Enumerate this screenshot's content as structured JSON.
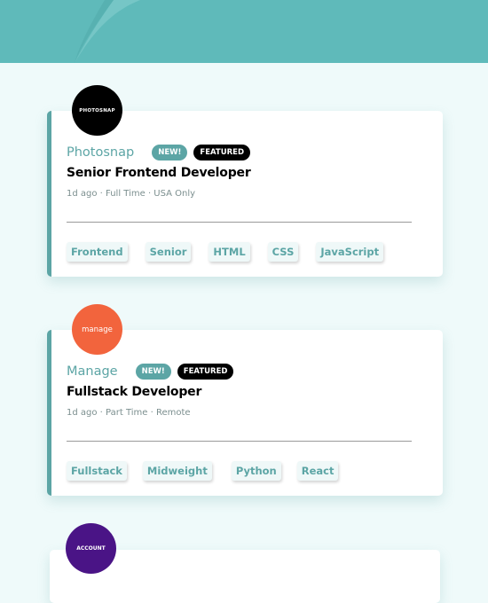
{
  "colors": {
    "header": "#5fbaba",
    "background": "#effafa",
    "accent": "#5ca5a5",
    "featured_badge": "#000000"
  },
  "jobs": [
    {
      "logo_text": "PHOTOSNAP",
      "logo_color": "#000000",
      "company": "Photosnap",
      "new_label": "NEW!",
      "featured_label": "FEATURED",
      "position": "Senior Frontend Developer",
      "meta": "1d ago · Full Time · USA Only",
      "tags": [
        "Frontend",
        "Senior",
        "HTML",
        "CSS",
        "JavaScript"
      ]
    },
    {
      "logo_text": "manage",
      "logo_color": "#f2643d",
      "company": "Manage",
      "new_label": "NEW!",
      "featured_label": "FEATURED",
      "position": "Fullstack Developer",
      "meta": "1d ago · Part Time · Remote",
      "tags": [
        "Fullstack",
        "Midweight",
        "Python",
        "React"
      ]
    },
    {
      "logo_text": "ACCOUNT",
      "logo_color": "#4a1486"
    }
  ]
}
